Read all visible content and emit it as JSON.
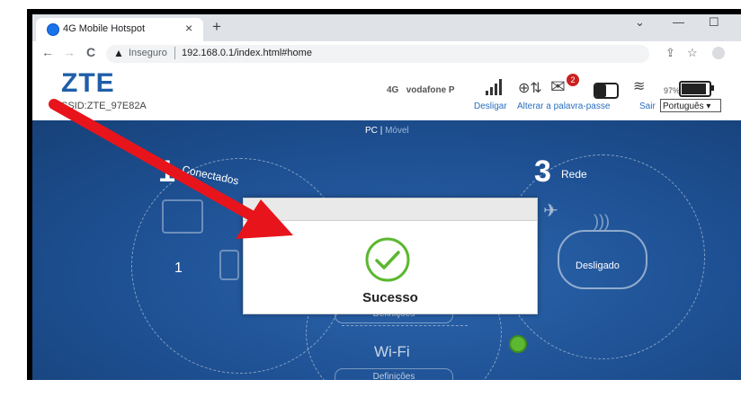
{
  "browser": {
    "tab_title": "4G Mobile Hotspot",
    "tab_close": "×",
    "new_tab": "+",
    "controls": {
      "dropdown": "⌄",
      "minimize": "—",
      "maximize": "☐"
    },
    "nav": {
      "back": "←",
      "forward": "→",
      "reload": "C"
    },
    "security_label": "Inseguro",
    "url": "192.168.0.1/index.html#home"
  },
  "router": {
    "logo": "ZTE",
    "ssid": "SSID:ZTE_97E82A",
    "network_type": "4G",
    "operator": "vodafone P",
    "unread_messages": "2",
    "battery_percent": "97%",
    "battery_level": 0.95,
    "links": {
      "disconnect": "Desligar",
      "change_password": "Alterar a palavra-passe",
      "logout": "Sair"
    },
    "language": "Português ▾"
  },
  "dashboard": {
    "view_pc": "PC",
    "view_separator": "|",
    "view_mobile": "Móvel",
    "connected_count": "1",
    "connected_label": "Conectados",
    "device_count": "1",
    "network_number": "3",
    "network_label": "Rede",
    "network_status": "Desligado",
    "wifi_title": "Wi-Fi",
    "settings_button": "Definições",
    "settings_button_2": "Definições"
  },
  "modal": {
    "message": "Sucesso"
  },
  "colors": {
    "zte_blue": "#1f5ea8",
    "success_green": "#5bb830",
    "annotation_red": "#e8141c"
  }
}
